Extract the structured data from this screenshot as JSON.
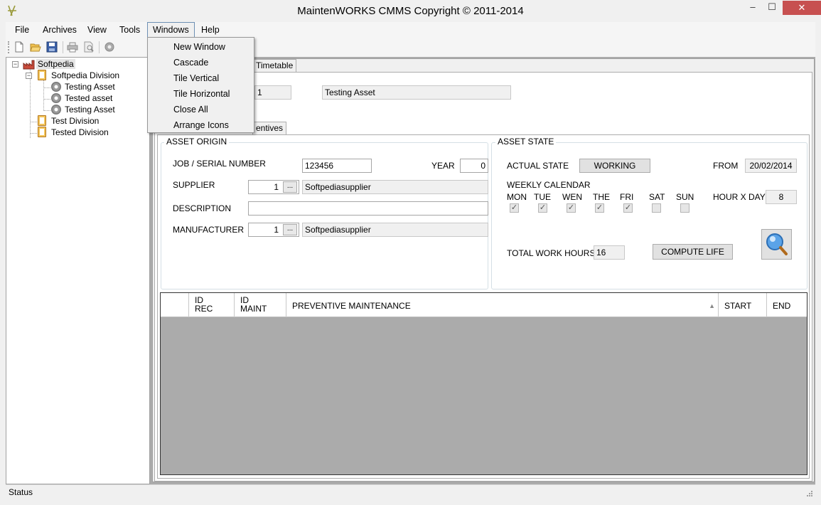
{
  "window": {
    "title": "MaintenWORKS CMMS Copyright © 2011-2014",
    "min_glyph": "–",
    "max_glyph": "☐",
    "close_glyph": "✕"
  },
  "menu": {
    "items": [
      "File",
      "Archives",
      "View",
      "Tools",
      "Windows",
      "Help"
    ],
    "active": "Windows"
  },
  "windows_menu": {
    "items": [
      "New Window",
      "Cascade",
      "Tile Vertical",
      "Tile Horizontal",
      "Close All",
      "Arrange Icons"
    ]
  },
  "toolbar": {
    "icons": [
      "new-file-icon",
      "open-folder-icon",
      "save-icon",
      "print-icon",
      "print-preview-icon",
      "settings-icon"
    ]
  },
  "tree": {
    "root": "Softpedia",
    "division1": "Softpedia Division",
    "asset1": "Testing Asset",
    "asset2": "Tested asset",
    "asset3": "Testing Asset",
    "division2": "Test Division",
    "division3": "Tested Division",
    "expanded_glyph": "−"
  },
  "tabs": {
    "timetable": "Timetable",
    "preventives": "entives"
  },
  "asset_header": {
    "id_value": "1",
    "name_value": "Testing Asset"
  },
  "asset_origin": {
    "title": "ASSET ORIGIN",
    "job_label": "JOB / SERIAL NUMBER",
    "job_value": "123456",
    "year_label": "YEAR",
    "year_value": "0",
    "supplier_label": "SUPPLIER",
    "supplier_id": "1",
    "supplier_name": "Softpediasupplier",
    "description_label": "DESCRIPTION",
    "description_value": "",
    "manufacturer_label": "MANUFACTURER",
    "manufacturer_id": "1",
    "manufacturer_name": "Softpediasupplier",
    "dots": "..."
  },
  "asset_state": {
    "title": "ASSET STATE",
    "actual_state_label": "ACTUAL STATE",
    "actual_state_value": "WORKING",
    "from_label": "FROM",
    "from_value": "20/02/2014",
    "weekly_label": "WEEKLY CALENDAR",
    "days": [
      "MON",
      "TUE",
      "WEN",
      "THE",
      "FRI",
      "SAT",
      "SUN"
    ],
    "days_checked": [
      true,
      true,
      true,
      true,
      true,
      false,
      false
    ],
    "hour_label": "HOUR X DAY",
    "hour_value": "8",
    "total_label": "TOTAL WORK HOURS",
    "total_value": "16",
    "compute_label": "COMPUTE LIFE",
    "check_glyph": "✓"
  },
  "grid": {
    "columns": [
      "ID\nREC",
      "ID\nMAINT",
      "PREVENTIVE MAINTENANCE",
      "START",
      "END"
    ],
    "col_id_rec_1": "ID",
    "col_id_rec_2": "REC",
    "col_id_maint_1": "ID",
    "col_id_maint_2": "MAINT",
    "col_prev": "PREVENTIVE MAINTENANCE",
    "col_start": "START",
    "col_end": "END",
    "sort_glyph": "▲"
  },
  "status": {
    "text": "Status"
  }
}
